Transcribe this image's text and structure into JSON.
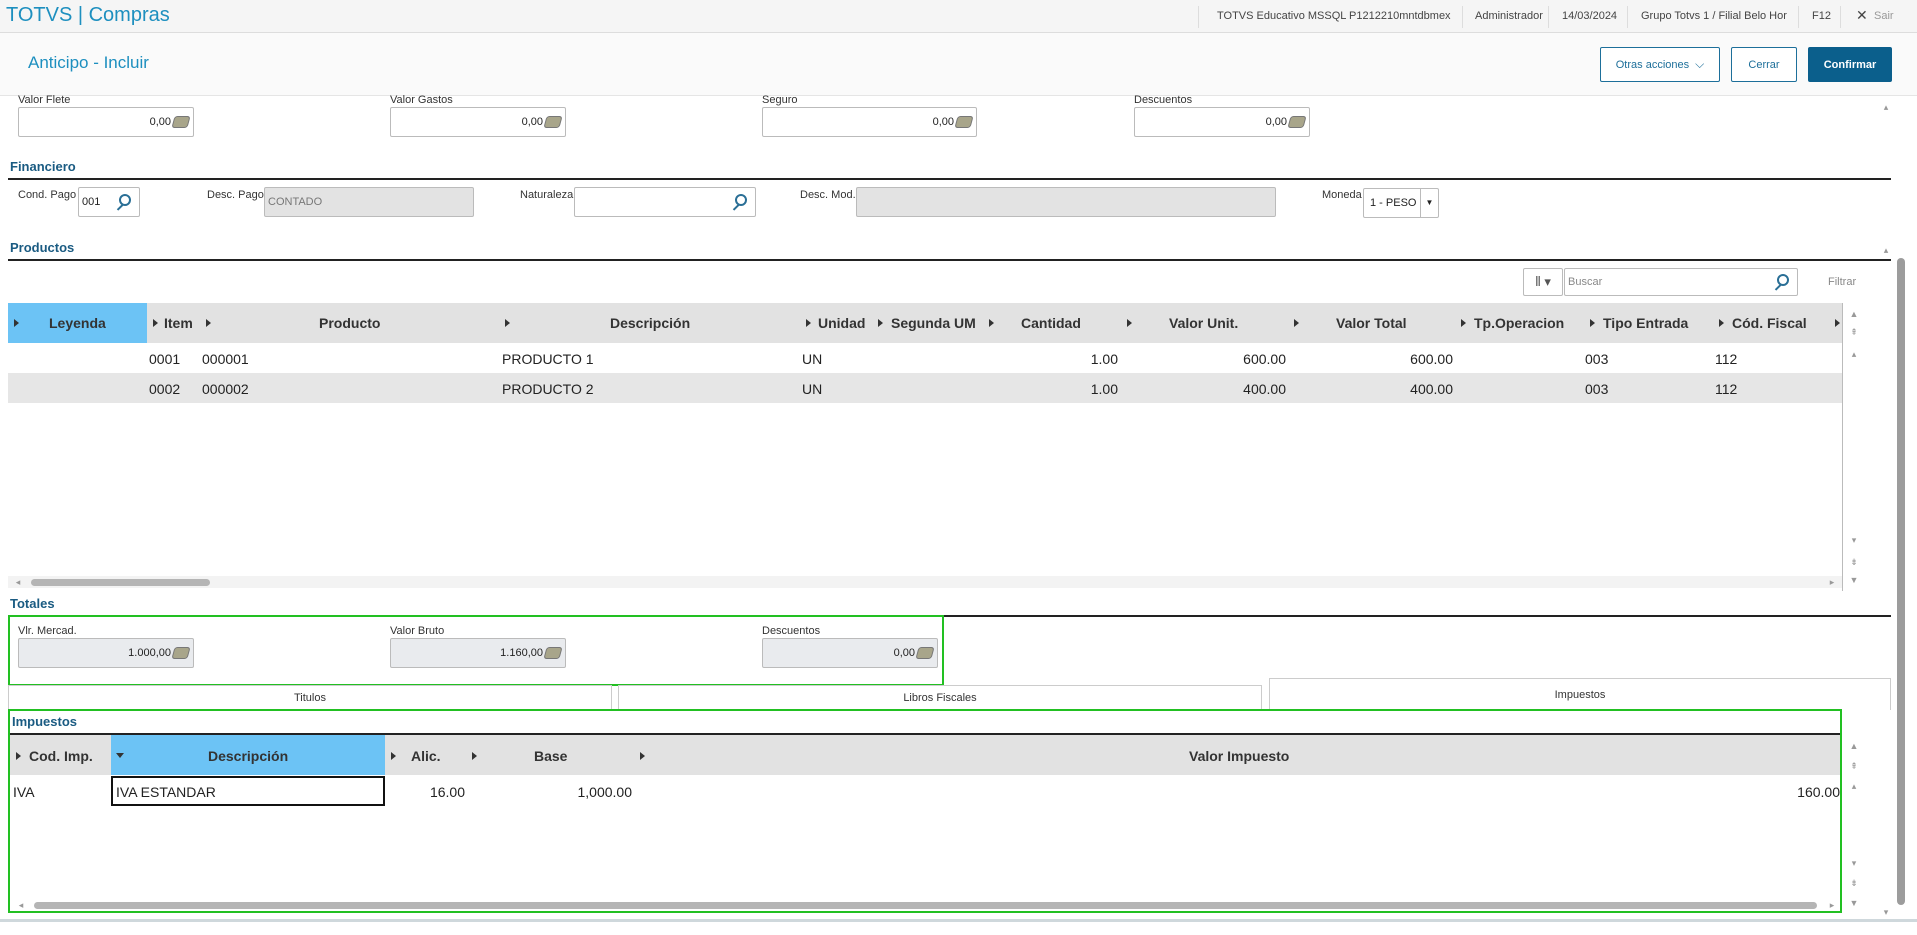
{
  "topbar": {
    "app_title": "TOTVS | Compras",
    "environment": "TOTVS Educativo MSSQL P1212210mntdbmex",
    "user": "Administrador",
    "date": "14/03/2024",
    "branch": "Grupo Totvs 1 / Filial Belo Hor",
    "f12": "F12",
    "exit": "Sair"
  },
  "header": {
    "title": "Anticipo - Incluir",
    "other_actions": "Otras acciones",
    "close": "Cerrar",
    "confirm": "Confirmar"
  },
  "costs": {
    "flete_label": "Valor Flete",
    "flete_value": "0,00",
    "gastos_label": "Valor Gastos",
    "gastos_value": "0,00",
    "seguro_label": "Seguro",
    "seguro_value": "0,00",
    "descuentos_label": "Descuentos",
    "descuentos_value": "0,00"
  },
  "financiero": {
    "title": "Financiero",
    "cond_pago_label": "Cond. Pago",
    "cond_pago_value": "001",
    "desc_pago_label": "Desc. Pago",
    "desc_pago_value": "CONTADO",
    "naturaleza_label": "Naturaleza",
    "naturaleza_value": "",
    "desc_mod_label": "Desc. Mod.",
    "desc_mod_value": "",
    "moneda_label": "Moneda",
    "moneda_value": "1 - PESO"
  },
  "productos": {
    "title": "Productos",
    "search_placeholder": "Buscar",
    "filter": "Filtrar",
    "columns": [
      "Leyenda",
      "Item",
      "Producto",
      "Descripción",
      "Unidad",
      "Segunda UM",
      "Cantidad",
      "Valor Unit.",
      "Valor Total",
      "Tp.Operacion",
      "Tipo Entrada",
      "Cód. Fiscal"
    ],
    "rows": [
      {
        "item": "0001",
        "producto": "000001",
        "descripcion": "PRODUCTO 1",
        "unidad": "UN",
        "cantidad": "1.00",
        "valor_unit": "600.00",
        "valor_total": "600.00",
        "tipo_entrada": "003",
        "cod_fiscal": "112"
      },
      {
        "item": "0002",
        "producto": "000002",
        "descripcion": "PRODUCTO 2",
        "unidad": "UN",
        "cantidad": "1.00",
        "valor_unit": "400.00",
        "valor_total": "400.00",
        "tipo_entrada": "003",
        "cod_fiscal": "112"
      }
    ]
  },
  "totales": {
    "title": "Totales",
    "mercad_label": "Vlr. Mercad.",
    "mercad_value": "1.000,00",
    "bruto_label": "Valor Bruto",
    "bruto_value": "1.160,00",
    "descuentos_label": "Descuentos",
    "descuentos_value": "0,00"
  },
  "tabs": [
    "Titulos",
    "Libros Fiscales",
    "Impuestos"
  ],
  "impuestos": {
    "title": "Impuestos",
    "columns": [
      "Cod. Imp.",
      "Descripción",
      "Alic.",
      "Base",
      "Valor Impuesto"
    ],
    "rows": [
      {
        "cod": "IVA",
        "descripcion": "IVA ESTANDAR",
        "alic": "16.00",
        "base": "1,000.00",
        "valor": "160.00"
      }
    ]
  },
  "colors": {
    "accent": "#1d8fbf",
    "primary_button": "#0b5f8c",
    "selected_header": "#6cc3f5",
    "highlight": "#22c022"
  }
}
